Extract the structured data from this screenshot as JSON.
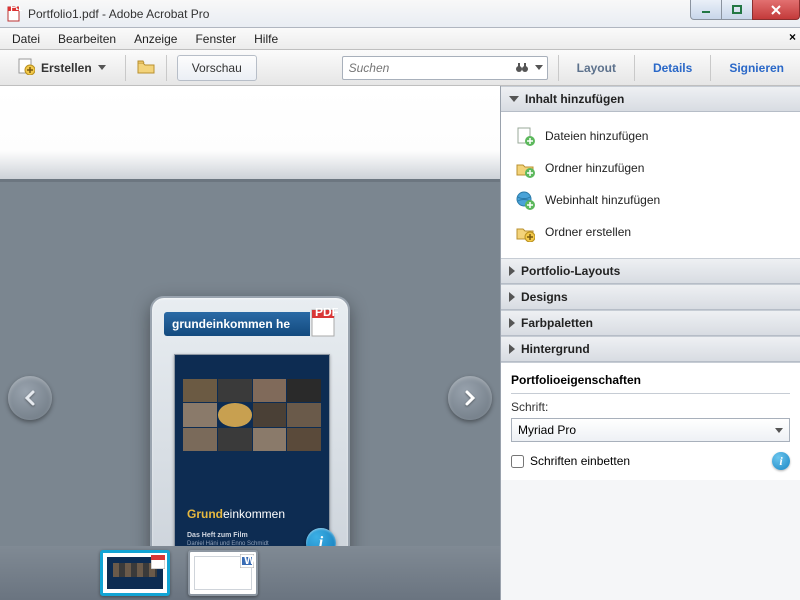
{
  "window": {
    "title": "Portfolio1.pdf - Adobe Acrobat Pro"
  },
  "menu": {
    "items": [
      "Datei",
      "Bearbeiten",
      "Anzeige",
      "Fenster",
      "Hilfe"
    ]
  },
  "toolbar": {
    "create": "Erstellen",
    "preview": "Vorschau",
    "search_placeholder": "Suchen",
    "tabs": {
      "layout": "Layout",
      "details": "Details",
      "sign": "Signieren"
    }
  },
  "card": {
    "filename": "grundeinkommen he",
    "cover_title_pre": "Grund",
    "cover_title_post": "einkommen",
    "cover_sub1": "Das Heft zum Film",
    "cover_sub2": "Daniel Häni und Enno Schmidt"
  },
  "panel": {
    "add_header": "Inhalt hinzufügen",
    "add_items": [
      "Dateien hinzufügen",
      "Ordner hinzufügen",
      "Webinhalt hinzufügen",
      "Ordner erstellen"
    ],
    "sections": [
      "Portfolio-Layouts",
      "Designs",
      "Farbpaletten",
      "Hintergrund"
    ],
    "props_header": "Portfolioeigenschaften",
    "font_label": "Schrift:",
    "font_value": "Myriad Pro",
    "embed_label": "Schriften einbetten"
  }
}
